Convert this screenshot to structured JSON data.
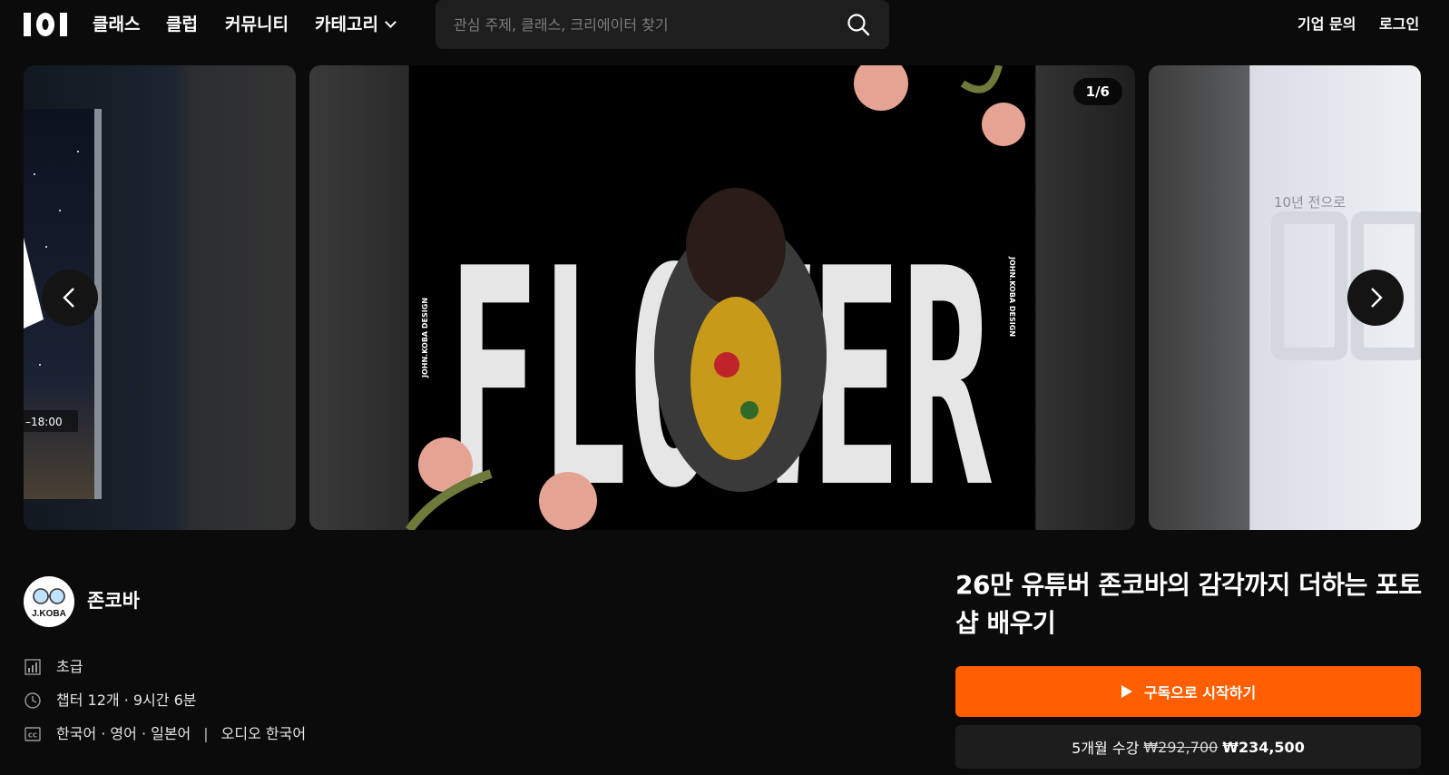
{
  "header": {
    "logo_icon": "class101-logo-icon",
    "nav": [
      "클래스",
      "클럽",
      "커뮤니티",
      "카테고리"
    ],
    "search_placeholder": "관심 주제, 클래스, 크리에이터 찾기",
    "links": [
      "기업 문의",
      "로그인"
    ]
  },
  "carousel": {
    "pager": "1/6",
    "left_slide_caption": "–18:00",
    "main_slide": {
      "headline": "FLOWER",
      "side_label": "JOHN.KOBA DESIGN"
    },
    "right_slide_caption": "10년 전으로"
  },
  "creator": {
    "name": "존코바",
    "avatar_text": "J.KOBA"
  },
  "meta": {
    "level": "초급",
    "duration": "챕터 12개 · 9시간 6분",
    "subtitles": "한국어 · 영어 · 일본어",
    "separator": "|",
    "audio": "오디오 한국어"
  },
  "product": {
    "title": "26만 유튜버 존코바의 감각까지 더하는 포토샵 배우기",
    "cta_label": "구독으로 시작하기",
    "price_prefix": "5개월 수강",
    "price_original": "₩292,700",
    "price_sale": "₩234,500"
  },
  "colors": {
    "accent": "#ff5f00",
    "background": "#0b0b0b",
    "surface": "#1d1d1d"
  }
}
